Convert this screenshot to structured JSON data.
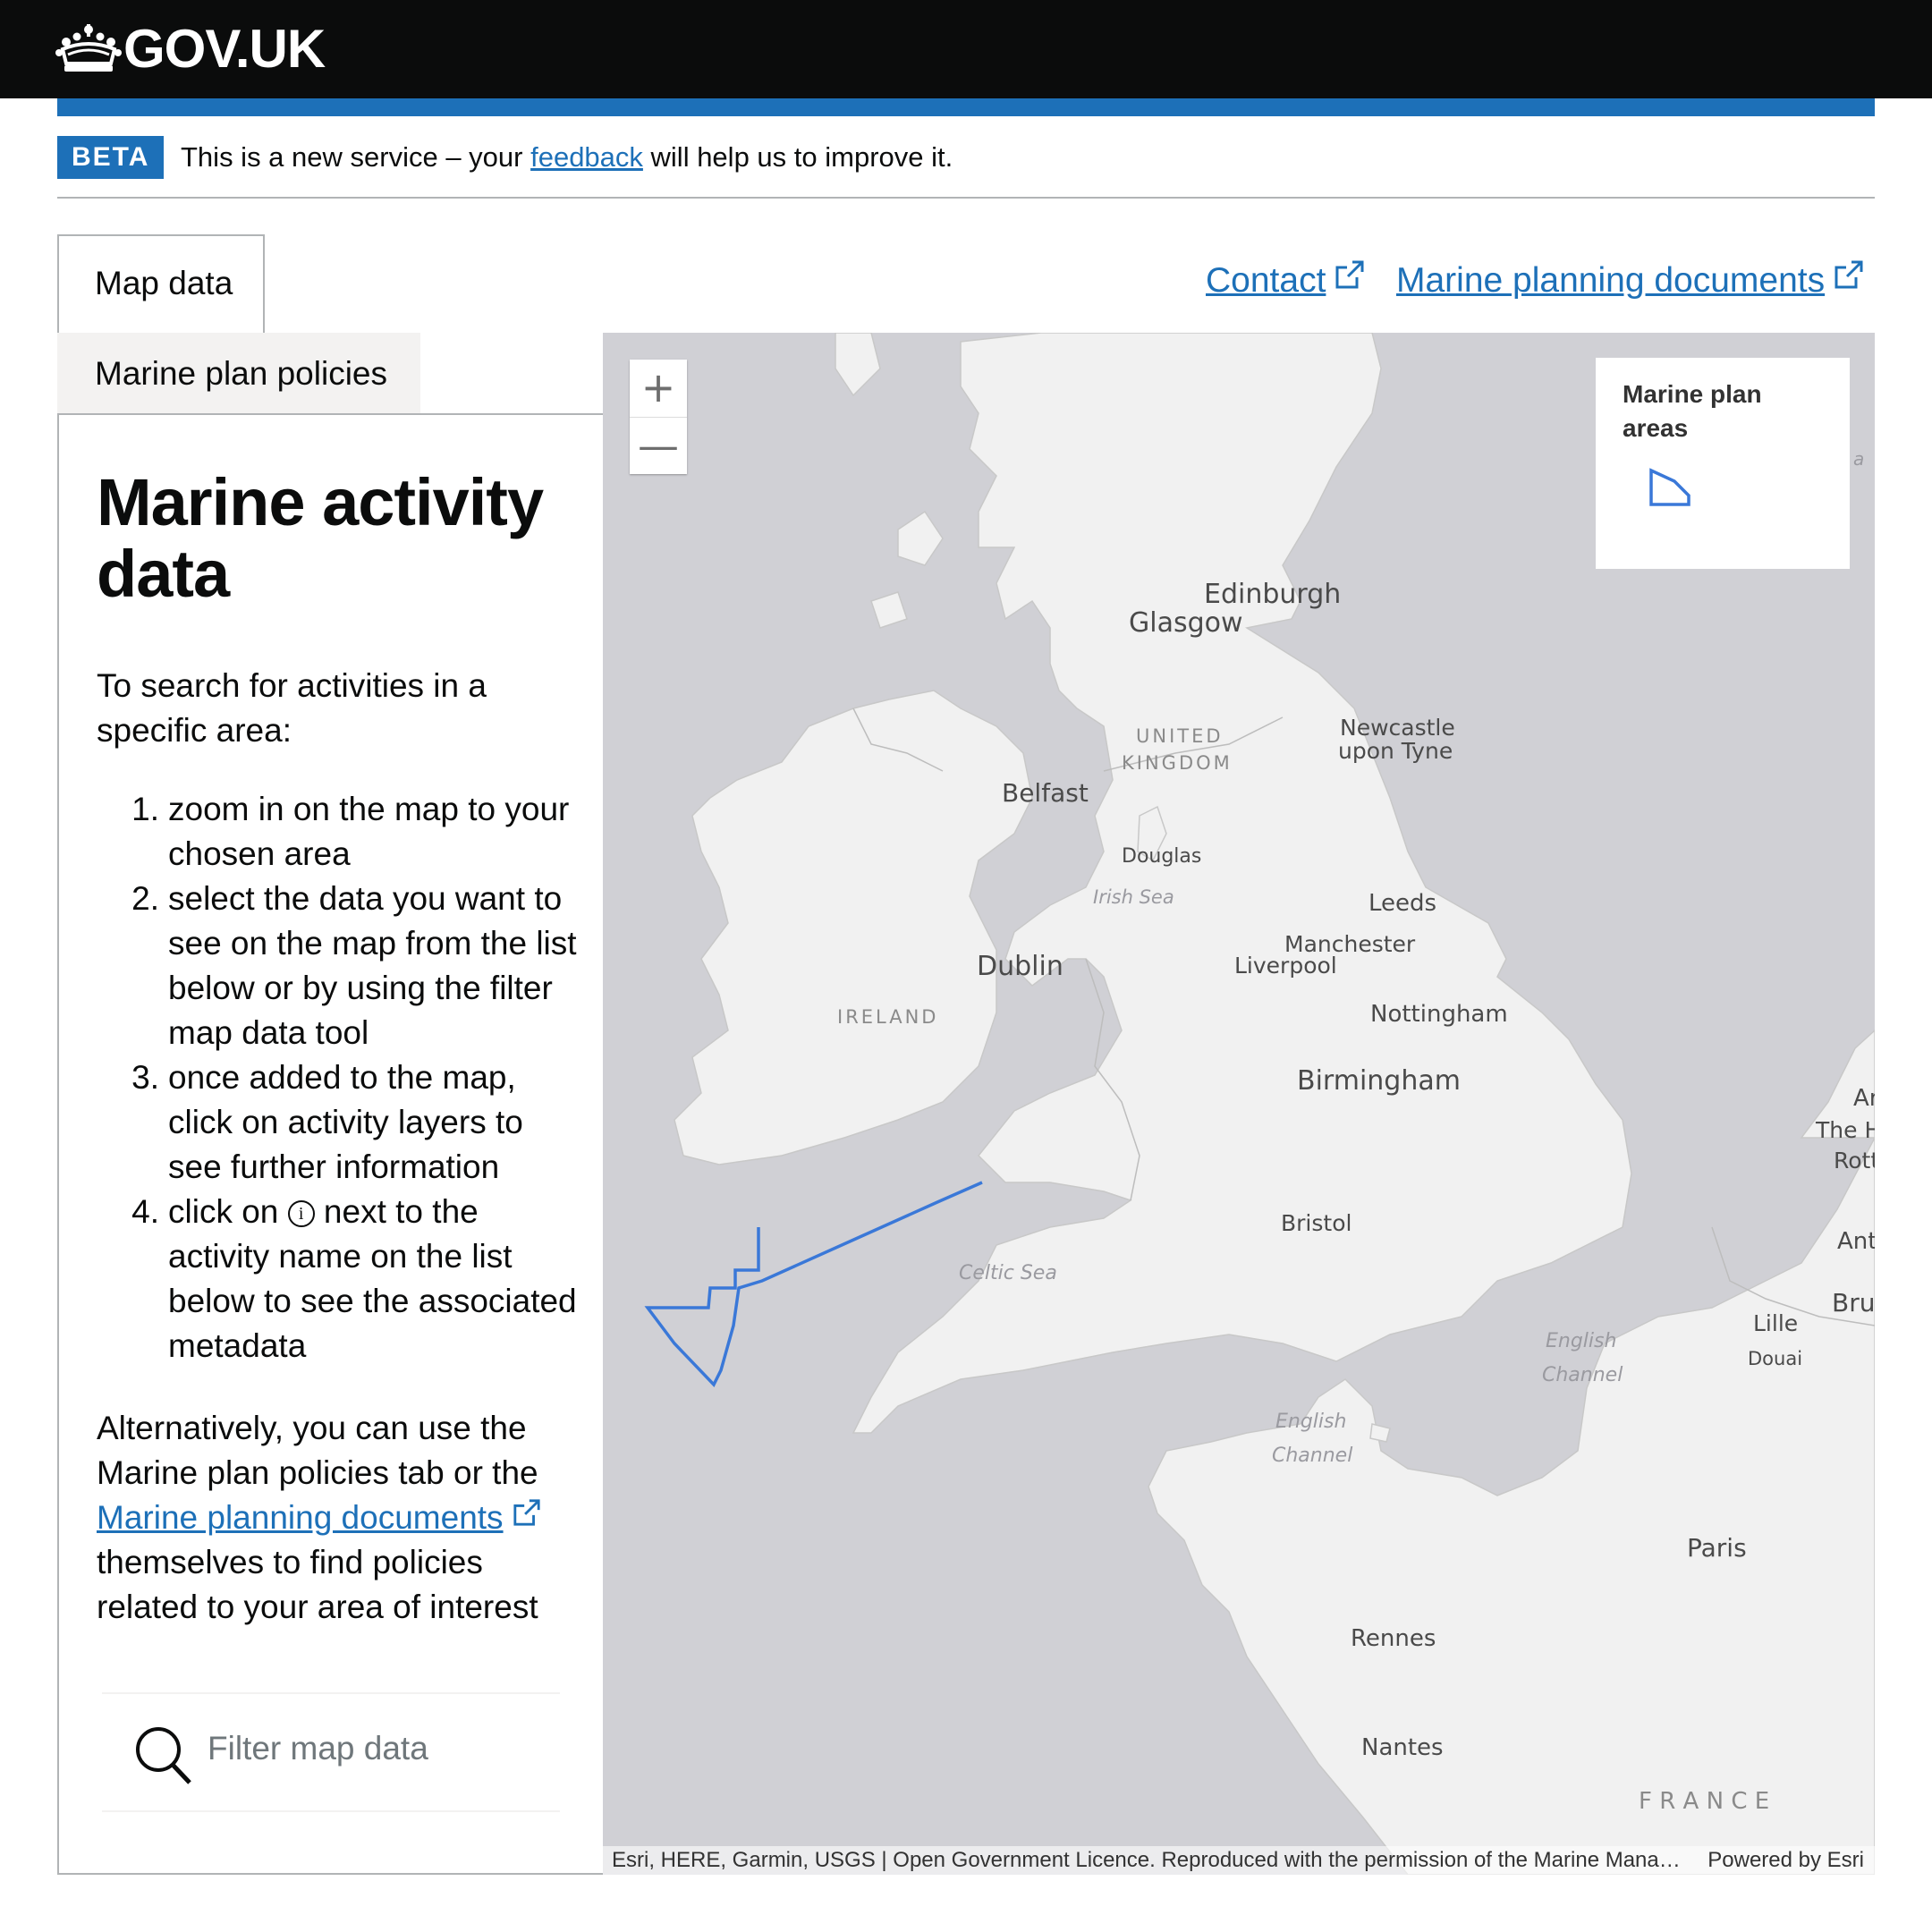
{
  "header": {
    "logo_text": "GOV.UK"
  },
  "phase_banner": {
    "tag": "BETA",
    "text_before": "This is a new service – your ",
    "link": "feedback",
    "text_after": " will help us to improve it."
  },
  "tabs": [
    {
      "label": "Map data",
      "active": true
    },
    {
      "label": "Marine plan policies",
      "active": false
    }
  ],
  "top_links": [
    {
      "label": "Contact"
    },
    {
      "label": "Marine planning documents"
    }
  ],
  "panel": {
    "title": "Marine activity data",
    "intro": "To search for activities in a specific area:",
    "steps": [
      {
        "num": "1.",
        "text": "zoom in on the map to your chosen area"
      },
      {
        "num": "2.",
        "text": "select the data you want to see on the map from the list below or by using the filter map data tool"
      },
      {
        "num": "3.",
        "text": "once added to the map, click on activity layers to see further information"
      },
      {
        "num": "4.",
        "before": "click on ",
        "icon": "info-icon",
        "after": " next to the activity name on the list below to see the associated metadata"
      }
    ],
    "alt_before": "Alternatively, you can use the Marine plan policies tab or the ",
    "alt_link": "Marine planning documents",
    "alt_after": " themselves to find policies related to your area of interest",
    "search": {
      "placeholder": "Filter map data",
      "value": ""
    }
  },
  "map": {
    "zoom_in": "+",
    "zoom_out": "—",
    "legend_title": "Marine plan areas",
    "labels": {
      "edinburgh": "Edinburgh",
      "glasgow": "Glasgow",
      "uk_line1": "UNITED",
      "uk_line2": "KINGDOM",
      "newcastle_line1": "Newcastle",
      "newcastle_line2": "upon Tyne",
      "belfast": "Belfast",
      "douglas": "Douglas",
      "irish_sea": "Irish Sea",
      "leeds": "Leeds",
      "manchester": "Manchester",
      "liverpool": "Liverpool",
      "dublin": "Dublin",
      "ireland": "IRELAND",
      "nottingham": "Nottingham",
      "birmingham": "Birmingham",
      "bristol": "Bristol",
      "celtic_sea": "Celtic Sea",
      "english_channel_1": "English",
      "english_channel_2": "Channel",
      "lille": "Lille",
      "douai": "Douai",
      "paris": "Paris",
      "rennes": "Rennes",
      "nantes": "Nantes",
      "france": "F R A N C E",
      "edge_1": "Ar",
      "edge_2": "The H",
      "edge_3": "Rott",
      "edge_4": "Ant",
      "edge_5": "Brus",
      "edge_6": "a"
    },
    "attribution": "Esri, HERE, Garmin, USGS | Open Government Licence. Reproduced with the permission of the Marine Management Organisation",
    "powered_by": "Powered by Esri"
  },
  "colors": {
    "header_bg": "#0b0c0c",
    "brand_blue": "#1d70b8",
    "link": "#1d70b8",
    "map_sea": "#d0d0d5",
    "map_land": "#f1f1f1",
    "plan_area_stroke": "#3a78d8"
  }
}
